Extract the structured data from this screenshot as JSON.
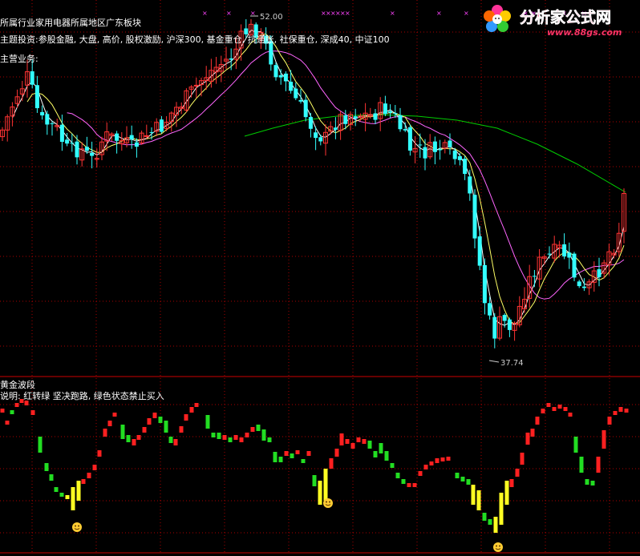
{
  "upper_panel": {
    "info_line_1": "所属行业家用电器所属地区广东板块",
    "info_line_2": "主题投资:参股金融, 大盘, 高价, 股权激励, 沪深300, 基金重仓, 抗通胀, 社保重仓, 深成40, 中证100",
    "info_line_3": "主营业务:",
    "high_label": "52.00",
    "low_label": "37.74"
  },
  "lower_panel": {
    "title": "黄金波段",
    "description": "说明: 红转绿 坚决跑路, 绿色状态禁止买入"
  },
  "logo": {
    "cn_text": "分析家公式网",
    "url_text": "www.88gs.com"
  },
  "colors": {
    "up": "#ff3333",
    "down": "#33ffff",
    "ma5": "#ffffff",
    "ma10": "#ffff66",
    "ma20": "#ff66ff",
    "ma60": "#00cc00",
    "ind_red": "#ff2020",
    "ind_green": "#22dd22",
    "ind_yellow": "#ffff22",
    "grid": "#aa0000"
  },
  "chart_data": {
    "type": "candlestick",
    "high": 52.0,
    "low": 37.74
  }
}
